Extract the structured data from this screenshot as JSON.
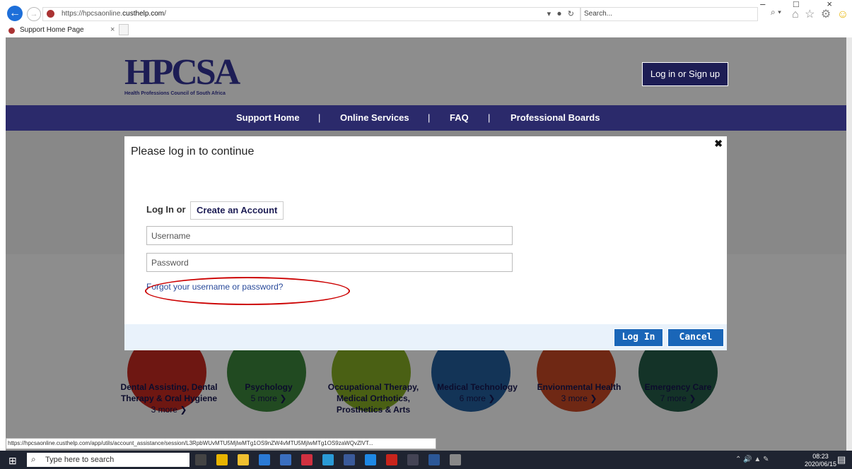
{
  "browser": {
    "url_prefix": "https://hpcsaonline.",
    "url_domain": "custhelp.com",
    "url_suffix": "/",
    "search_placeholder": "Search...",
    "tab_title": "Support Home Page",
    "tab_close": "×"
  },
  "site": {
    "logo_text": "HPCSA",
    "logo_subtitle": "Health Professions Council of South Africa",
    "login_button": "Log in or Sign up",
    "nav": [
      "Support Home",
      "Online Services",
      "FAQ",
      "Professional Boards"
    ],
    "nav_separator": "|"
  },
  "categories": [
    {
      "title": "Dental Assisting, Dental Therapy & Oral Hygiene",
      "more": "3 more",
      "color": "#a32018"
    },
    {
      "title": "Psychology",
      "more": "5 more",
      "color": "#2f6a2f"
    },
    {
      "title": "Occupational Therapy, Medical Orthotics, Prosthetics & Arts",
      "more": "",
      "color": "#6a8a1e"
    },
    {
      "title": "Medical Technology",
      "more": "6 more",
      "color": "#1d4b7a"
    },
    {
      "title": "Envionmental Health",
      "more": "3 more",
      "color": "#a03a1e"
    },
    {
      "title": "Emergency Care",
      "more": "7 more",
      "color": "#1e4a3a"
    }
  ],
  "modal": {
    "title": "Please log in to continue",
    "close": "✖",
    "login_label": "Log In or",
    "create_account": "Create an Account",
    "username_placeholder": "Username",
    "password_placeholder": "Password",
    "forgot": "Forgot your username or password?",
    "login_button": "Log In",
    "cancel_button": "Cancel"
  },
  "status_url": "https://hpcsaonline.custhelp.com/app/utils/account_assistance/session/L3RpbWUvMTU5MjIwMTg1OS9nZW4vMTU5MjIwMTg1OS9zaWQvZlVT...",
  "taskbar": {
    "search_placeholder": "Type here to search",
    "time": "08:23",
    "date": "2020/06/15"
  }
}
